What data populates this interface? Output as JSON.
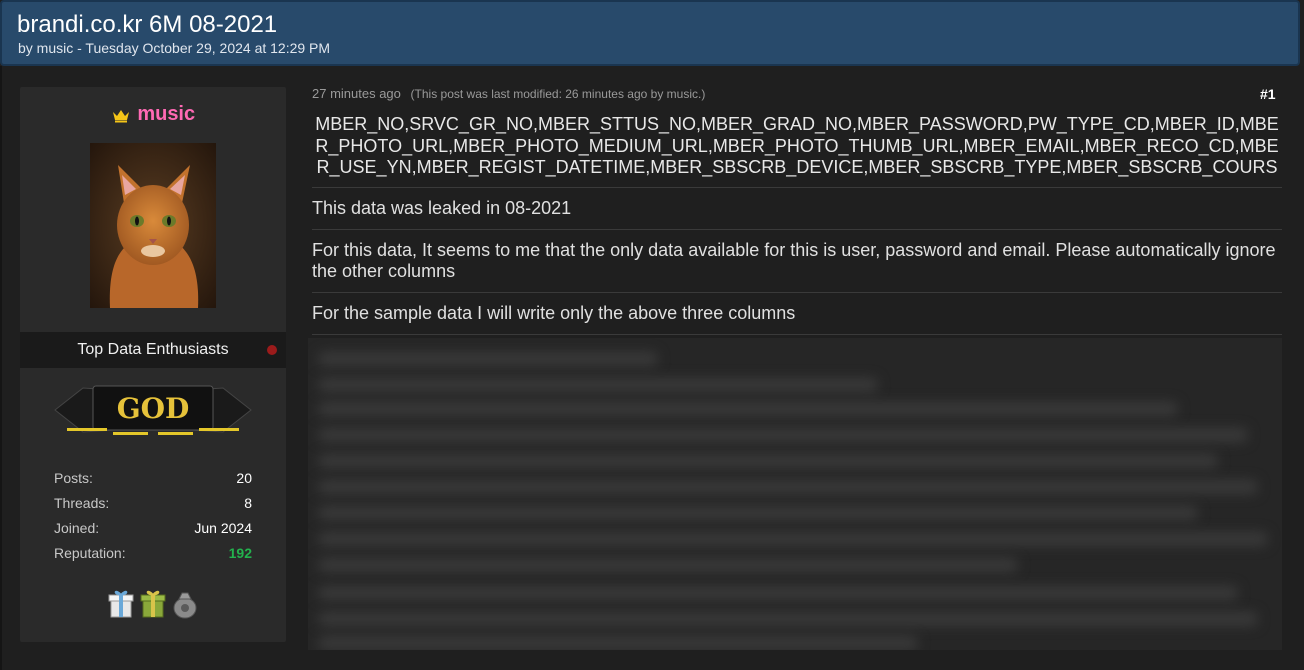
{
  "header": {
    "title": "brandi.co.kr 6M 08-2021",
    "meta": "by music - Tuesday October 29, 2024 at 12:29 PM"
  },
  "user": {
    "username": "music",
    "icons": {
      "crown": "crown-icon",
      "avatar": "cat-avatar-image"
    },
    "usertitle": "Top Data Enthusiasts",
    "rank_badge_text": "GOD",
    "stats": [
      {
        "label": "Posts:",
        "value": "20"
      },
      {
        "label": "Threads:",
        "value": "8"
      },
      {
        "label": "Joined:",
        "value": "Jun 2024"
      },
      {
        "label": "Reputation:",
        "value": "192"
      }
    ],
    "awards": [
      "white-gift-icon",
      "green-gift-icon",
      "gray-bag-icon"
    ],
    "colors": {
      "username": "#ff69b4",
      "reputation": "#23b14d",
      "offline": "#9b1b1b"
    }
  },
  "post": {
    "relative_time": "27 minutes ago",
    "modified_note": "(This post was last modified: 26 minutes ago by music.)",
    "number": "#1",
    "columns": "MBER_NO,SRVC_GR_NO,MBER_STTUS_NO,MBER_GRAD_NO,MBER_PASSWORD,PW_TYPE_CD,MBER_ID,MBER_PHOTO_URL,MBER_PHOTO_MEDIUM_URL,MBER_PHOTO_THUMB_URL,MBER_EMAIL,MBER_RECO_CD,MBER_USE_YN,MBER_REGIST_DATETIME,MBER_SBSCRB_DEVICE,MBER_SBSCRB_TYPE,MBER_SBSCRB_COURS",
    "paragraphs": [
      "This data was leaked in 08-2021",
      "For this data, It seems to me that the only data available for this is user, password and email. Please automatically ignore the other columns",
      "For the sample data I will write only the above three columns"
    ]
  },
  "theme": {
    "header_bg": "#284a6b",
    "page_bg": "#202020",
    "panel_bg": "#2a2a2a"
  }
}
